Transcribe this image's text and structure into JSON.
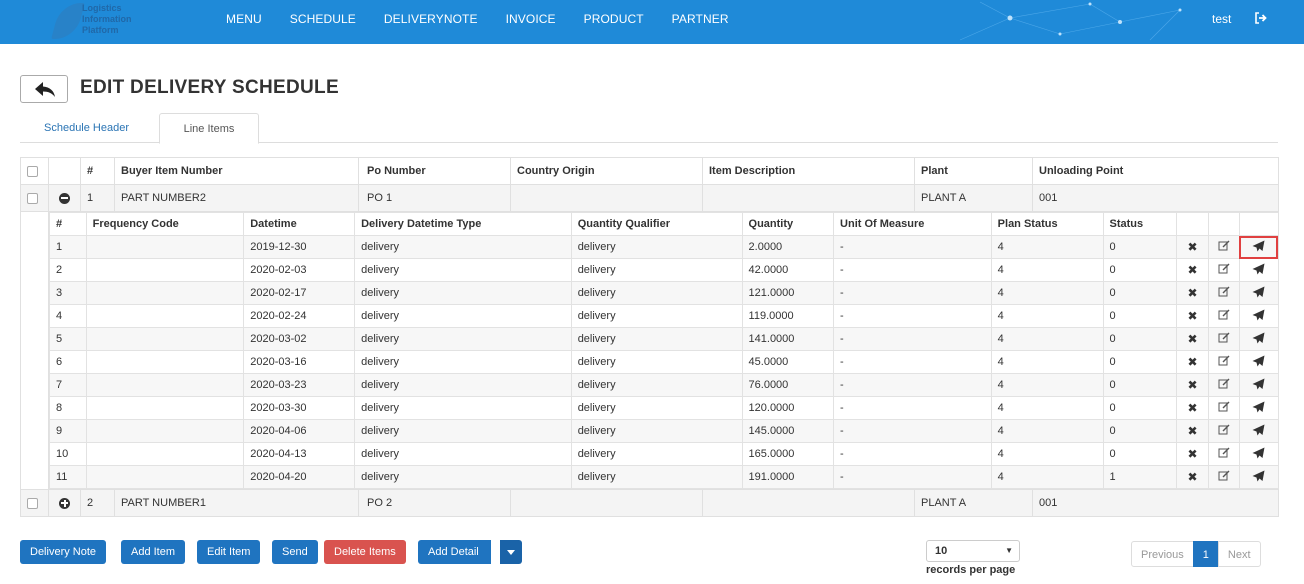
{
  "brand": {
    "logo_text": "Logistics Information Platform"
  },
  "nav": {
    "items": [
      "MENU",
      "SCHEDULE",
      "DELIVERYNOTE",
      "INVOICE",
      "PRODUCT",
      "PARTNER"
    ],
    "user": "test"
  },
  "page": {
    "title": "EDIT DELIVERY SCHEDULE"
  },
  "tabs": [
    "Schedule Header",
    "Line Items"
  ],
  "table": {
    "headers": [
      "#",
      "Buyer Item Number",
      "Po Number",
      "Country Origin",
      "Item Description",
      "Plant",
      "Unloading Point"
    ],
    "items": [
      {
        "num": "1",
        "buyer_item": "PART NUMBER2",
        "po": "PO 1",
        "country": "",
        "desc": "",
        "plant": "PLANT A",
        "unloading": "001"
      },
      {
        "num": "2",
        "buyer_item": "PART NUMBER1",
        "po": "PO 2",
        "country": "",
        "desc": "",
        "plant": "PLANT A",
        "unloading": "001"
      }
    ],
    "detail_headers": [
      "#",
      "Frequency Code",
      "Datetime",
      "Delivery Datetime Type",
      "Quantity Qualifier",
      "Quantity",
      "Unit Of Measure",
      "Plan Status",
      "Status"
    ],
    "details": [
      {
        "num": "1",
        "freq": "",
        "datetime": "2019-12-30",
        "type": "delivery",
        "qualifier": "delivery",
        "qty": "2.0000",
        "uom": "-",
        "plan": "4",
        "status": "0"
      },
      {
        "num": "2",
        "freq": "",
        "datetime": "2020-02-03",
        "type": "delivery",
        "qualifier": "delivery",
        "qty": "42.0000",
        "uom": "-",
        "plan": "4",
        "status": "0"
      },
      {
        "num": "3",
        "freq": "",
        "datetime": "2020-02-17",
        "type": "delivery",
        "qualifier": "delivery",
        "qty": "121.0000",
        "uom": "-",
        "plan": "4",
        "status": "0"
      },
      {
        "num": "4",
        "freq": "",
        "datetime": "2020-02-24",
        "type": "delivery",
        "qualifier": "delivery",
        "qty": "119.0000",
        "uom": "-",
        "plan": "4",
        "status": "0"
      },
      {
        "num": "5",
        "freq": "",
        "datetime": "2020-03-02",
        "type": "delivery",
        "qualifier": "delivery",
        "qty": "141.0000",
        "uom": "-",
        "plan": "4",
        "status": "0"
      },
      {
        "num": "6",
        "freq": "",
        "datetime": "2020-03-16",
        "type": "delivery",
        "qualifier": "delivery",
        "qty": "45.0000",
        "uom": "-",
        "plan": "4",
        "status": "0"
      },
      {
        "num": "7",
        "freq": "",
        "datetime": "2020-03-23",
        "type": "delivery",
        "qualifier": "delivery",
        "qty": "76.0000",
        "uom": "-",
        "plan": "4",
        "status": "0"
      },
      {
        "num": "8",
        "freq": "",
        "datetime": "2020-03-30",
        "type": "delivery",
        "qualifier": "delivery",
        "qty": "120.0000",
        "uom": "-",
        "plan": "4",
        "status": "0"
      },
      {
        "num": "9",
        "freq": "",
        "datetime": "2020-04-06",
        "type": "delivery",
        "qualifier": "delivery",
        "qty": "145.0000",
        "uom": "-",
        "plan": "4",
        "status": "0"
      },
      {
        "num": "10",
        "freq": "",
        "datetime": "2020-04-13",
        "type": "delivery",
        "qualifier": "delivery",
        "qty": "165.0000",
        "uom": "-",
        "plan": "4",
        "status": "0"
      },
      {
        "num": "11",
        "freq": "",
        "datetime": "2020-04-20",
        "type": "delivery",
        "qualifier": "delivery",
        "qty": "191.0000",
        "uom": "-",
        "plan": "4",
        "status": "1"
      }
    ]
  },
  "actions": {
    "delivery_note": "Delivery Note",
    "add_item": "Add Item",
    "edit_item": "Edit Item",
    "send": "Send",
    "delete_items": "Delete Items",
    "add_detail": "Add Detail"
  },
  "pagination": {
    "page_size": "10",
    "records_label": "records per page",
    "previous": "Previous",
    "current": "1",
    "next": "Next"
  },
  "icons": {
    "delete": "times-icon",
    "edit": "edit-icon",
    "send": "paper-plane-icon",
    "back": "reply-arrow-icon",
    "logout": "logout-icon"
  },
  "colors": {
    "navbar": "#1f8ad8",
    "primary": "#1f74c0",
    "danger": "#d9534f"
  }
}
